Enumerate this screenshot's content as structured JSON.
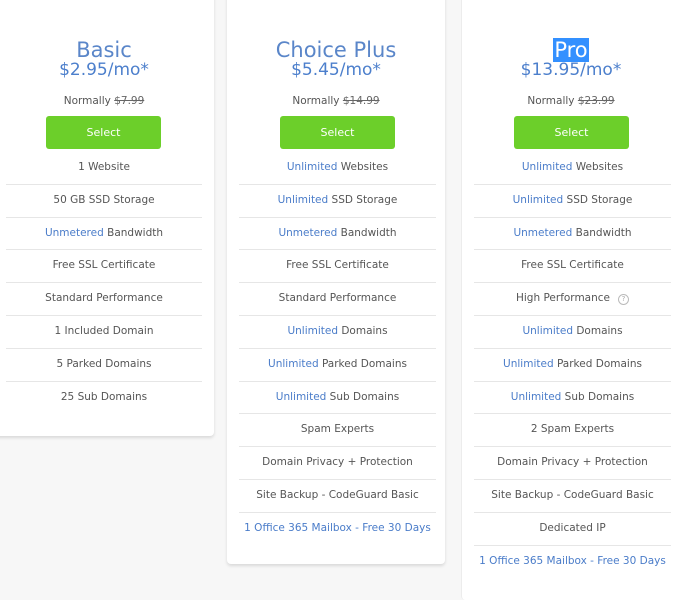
{
  "plans": [
    {
      "name": "Basic",
      "price": "$2.95/mo*",
      "normally_label": "Normally",
      "normal_price": "$7.99",
      "select_label": "Select",
      "features": [
        {
          "highlight": "",
          "text": "1 Website"
        },
        {
          "highlight": "",
          "text": "50 GB SSD Storage"
        },
        {
          "highlight": "Unmetered",
          "text": " Bandwidth"
        },
        {
          "highlight": "",
          "text": "Free SSL Certificate"
        },
        {
          "highlight": "",
          "text": "Standard Performance"
        },
        {
          "highlight": "",
          "text": "1 Included Domain"
        },
        {
          "highlight": "",
          "text": "5 Parked Domains"
        },
        {
          "highlight": "",
          "text": "25 Sub Domains"
        }
      ]
    },
    {
      "name": "Choice Plus",
      "price": "$5.45/mo*",
      "normally_label": "Normally",
      "normal_price": "$14.99",
      "select_label": "Select",
      "features": [
        {
          "highlight": "Unlimited",
          "text": " Websites"
        },
        {
          "highlight": "Unlimited",
          "text": " SSD Storage"
        },
        {
          "highlight": "Unmetered",
          "text": " Bandwidth"
        },
        {
          "highlight": "",
          "text": "Free SSL Certificate"
        },
        {
          "highlight": "",
          "text": "Standard Performance"
        },
        {
          "highlight": "Unlimited",
          "text": " Domains"
        },
        {
          "highlight": "Unlimited",
          "text": " Parked Domains"
        },
        {
          "highlight": "Unlimited",
          "text": " Sub Domains"
        },
        {
          "highlight": "",
          "text": "Spam Experts"
        },
        {
          "highlight": "",
          "text": "Domain Privacy + Protection"
        },
        {
          "highlight": "",
          "text": "Site Backup - CodeGuard Basic"
        },
        {
          "highlight": "",
          "text": "",
          "link": "1 Office 365 Mailbox - Free 30 Days"
        }
      ]
    },
    {
      "name": "Pro",
      "name_selected": true,
      "price": "$13.95/mo*",
      "normally_label": "Normally",
      "normal_price": "$23.99",
      "select_label": "Select",
      "features": [
        {
          "highlight": "Unlimited",
          "text": " Websites"
        },
        {
          "highlight": "Unlimited",
          "text": " SSD Storage"
        },
        {
          "highlight": "Unmetered",
          "text": " Bandwidth"
        },
        {
          "highlight": "",
          "text": "Free SSL Certificate"
        },
        {
          "highlight": "",
          "text": "High Performance",
          "help_icon": "help-circle-icon",
          "help_glyph": "?"
        },
        {
          "highlight": "Unlimited",
          "text": " Domains"
        },
        {
          "highlight": "Unlimited",
          "text": " Parked Domains"
        },
        {
          "highlight": "Unlimited",
          "text": " Sub Domains"
        },
        {
          "highlight": "",
          "text": "2 Spam Experts"
        },
        {
          "highlight": "",
          "text": "Domain Privacy + Protection"
        },
        {
          "highlight": "",
          "text": "Site Backup - CodeGuard Basic"
        },
        {
          "highlight": "",
          "text": "Dedicated IP"
        },
        {
          "highlight": "",
          "text": "",
          "link": "1 Office 365 Mailbox - Free 30 Days"
        }
      ]
    }
  ],
  "colors": {
    "accent_blue": "#4a7cc9",
    "button_green": "#6ccf2a",
    "selection_blue": "#3390ff",
    "background": "#f7f7f7"
  }
}
